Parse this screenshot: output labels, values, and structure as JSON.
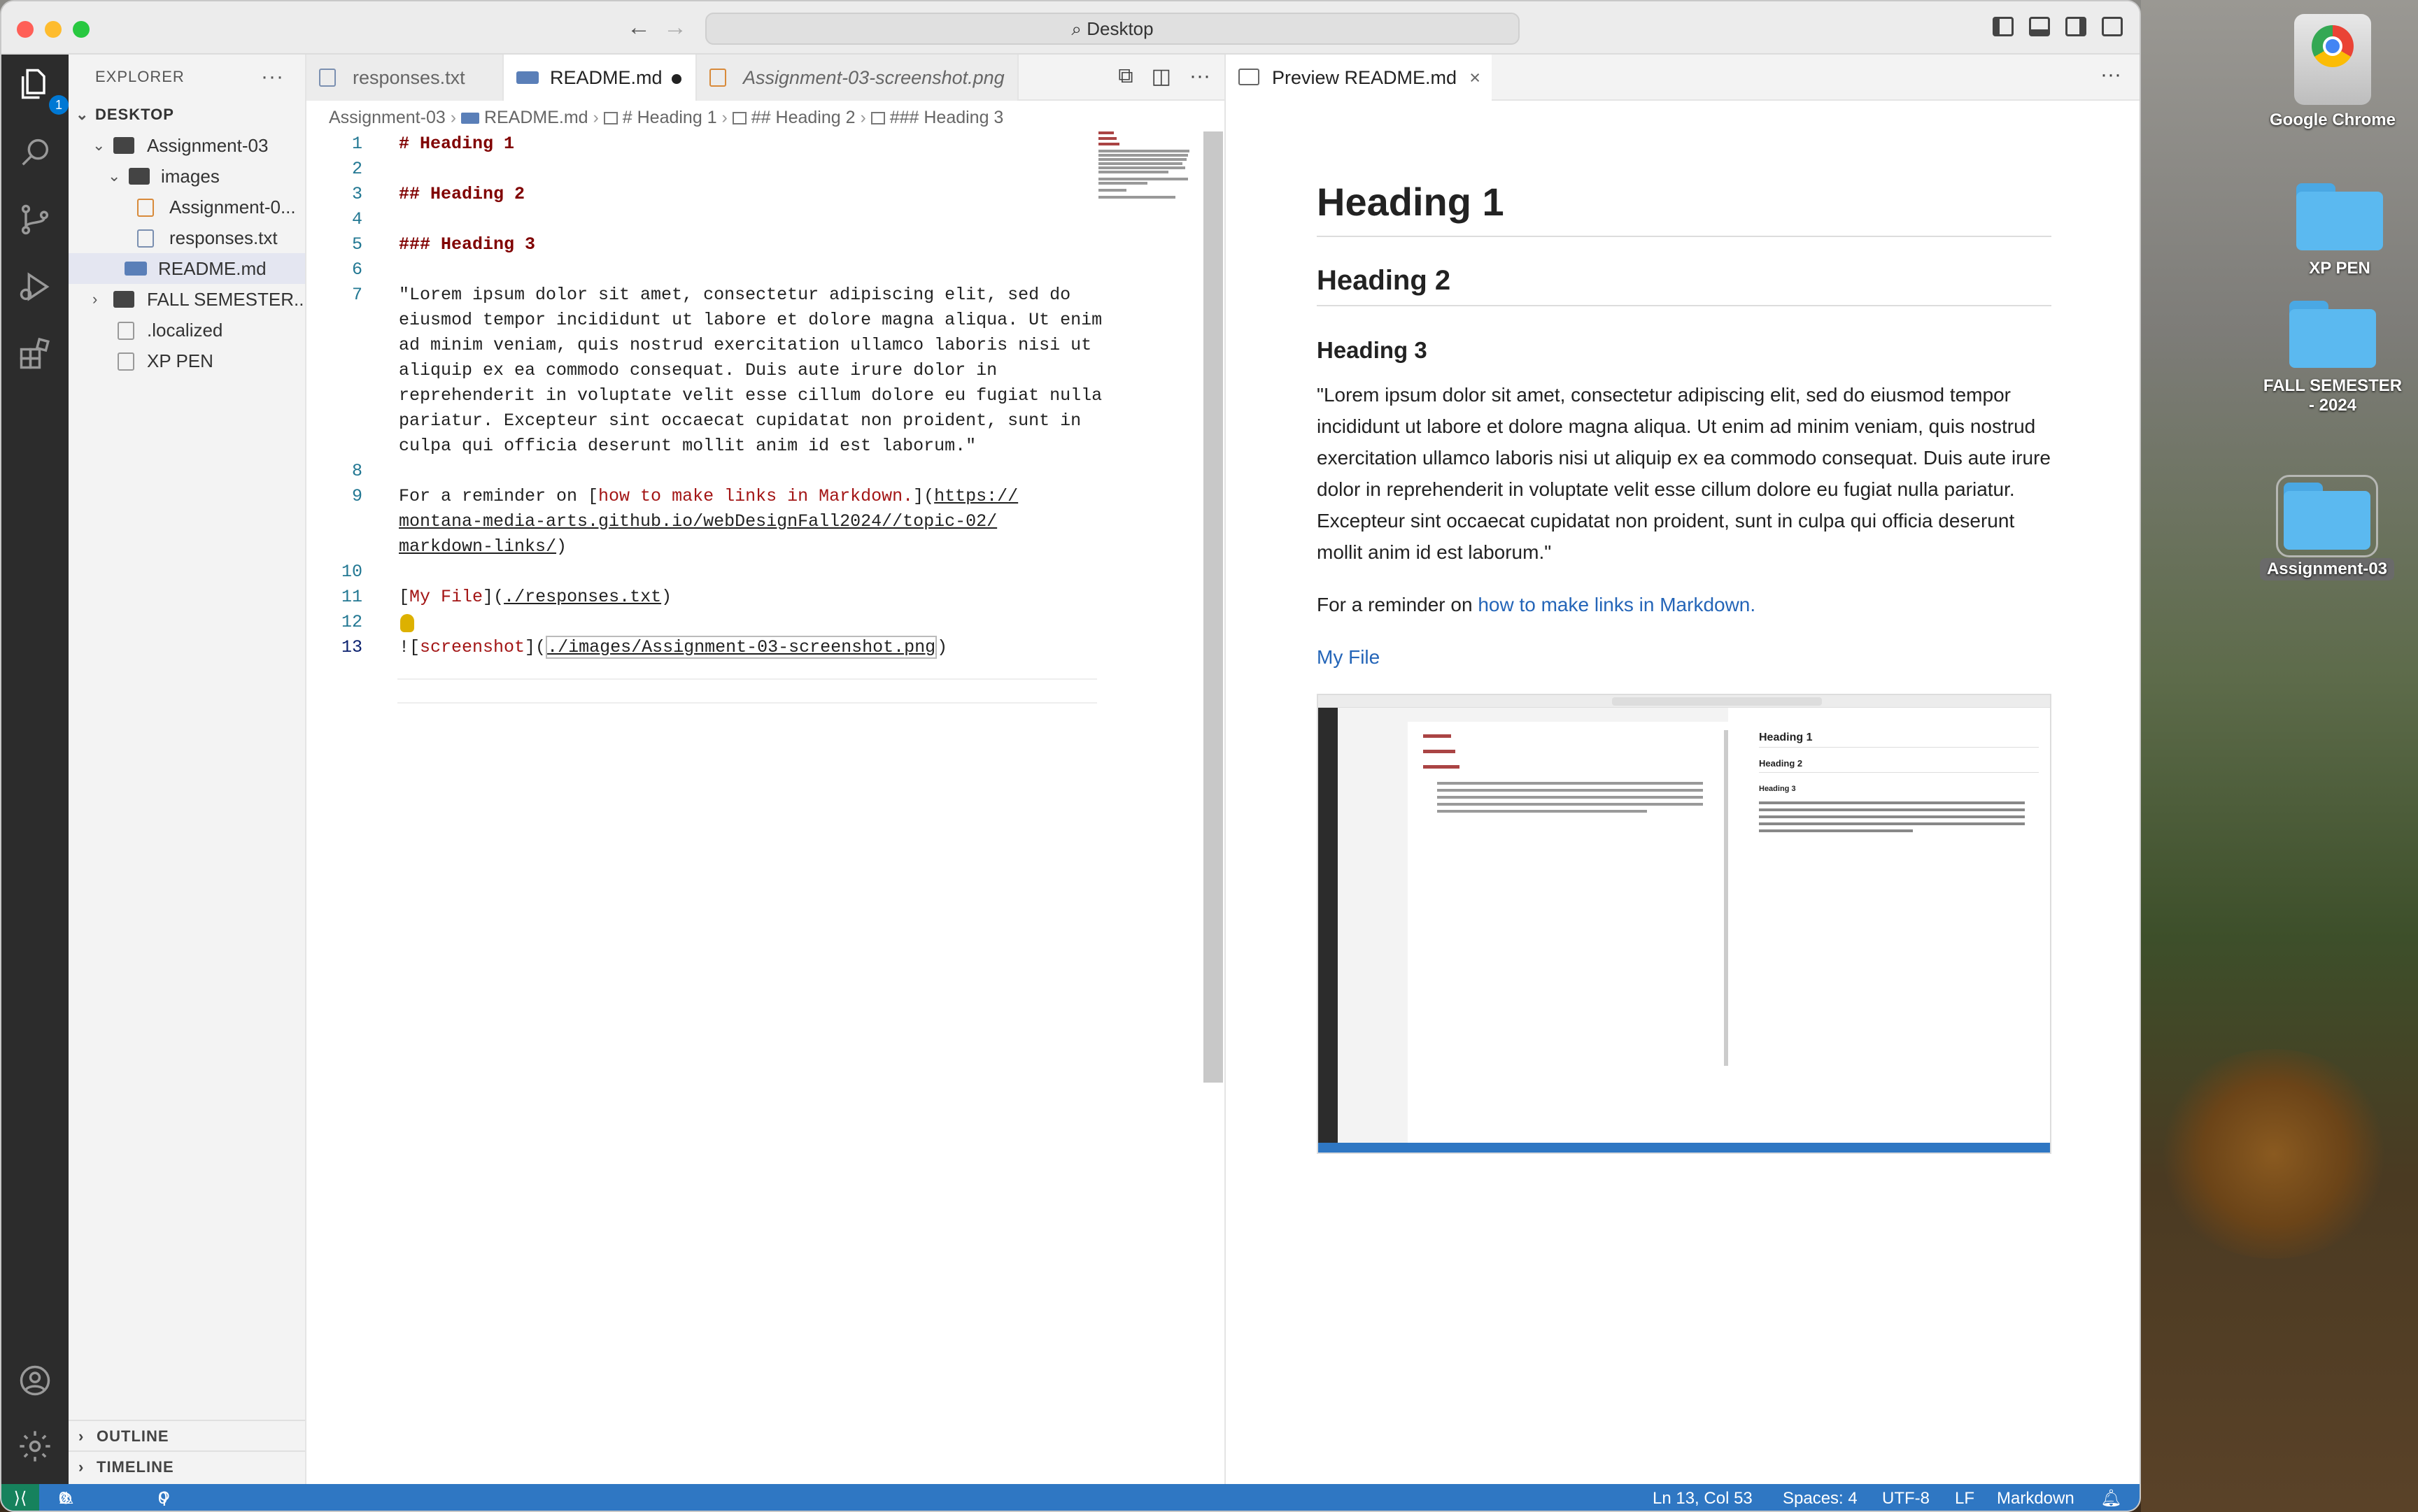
{
  "window": {
    "search_label": "Desktop"
  },
  "activity": {
    "explorer_badge": "1"
  },
  "sidebar": {
    "title": "EXPLORER",
    "section": "DESKTOP",
    "tree": [
      {
        "label": "Assignment-03",
        "type": "folder",
        "depth": 0,
        "open": true
      },
      {
        "label": "images",
        "type": "folder",
        "depth": 1,
        "open": true
      },
      {
        "label": "Assignment-0...",
        "type": "image",
        "depth": 2
      },
      {
        "label": "responses.txt",
        "type": "text",
        "depth": 2
      },
      {
        "label": "README.md",
        "type": "markdown",
        "depth": 1,
        "selected": true
      },
      {
        "label": "FALL SEMESTER...",
        "type": "folder",
        "depth": 0,
        "open": false
      },
      {
        "label": ".localized",
        "type": "text",
        "depth": 0
      },
      {
        "label": "XP PEN",
        "type": "text",
        "depth": 0
      }
    ],
    "outline": "OUTLINE",
    "timeline": "TIMELINE"
  },
  "editor": {
    "tabs": [
      {
        "label": "responses.txt",
        "dirty": false
      },
      {
        "label": "README.md",
        "dirty": true,
        "active": true
      },
      {
        "label": "Assignment-03-screenshot.png",
        "italic": true
      }
    ],
    "breadcrumb": [
      "Assignment-03",
      "README.md",
      "# Heading 1",
      "## Heading 2",
      "### Heading 3"
    ],
    "line_numbers": [
      "1",
      "2",
      "3",
      "4",
      "5",
      "6",
      "7",
      "8",
      "9",
      "10",
      "11",
      "12",
      "13"
    ],
    "lines": {
      "l1": "# Heading 1",
      "l3": "## Heading 2",
      "l5": "### Heading 3",
      "l7a": "\"Lorem ipsum dolor sit amet, consectetur adipiscing elit, sed do",
      "l7b": "eiusmod tempor incididunt ut labore et dolore magna aliqua. Ut enim",
      "l7c": "ad minim veniam, quis nostrud exercitation ullamco laboris nisi ut",
      "l7d": "aliquip ex ea commodo consequat. Duis aute irure dolor in",
      "l7e": "reprehenderit in voluptate velit esse cillum dolore eu fugiat nulla",
      "l7f": "pariatur. Excepteur sint occaecat cupidatat non proident, sunt in",
      "l7g": "culpa qui officia deserunt mollit anim id est laborum.\"",
      "l9_pre": "For a reminder on [",
      "l9_text": "how to make links in Markdown.",
      "l9_mid": "](",
      "l9_url1": "https://",
      "l9_url2": "montana-media-arts.github.io/webDesignFall2024//topic-02/",
      "l9_url3": "markdown-links/",
      "l9_end": ")",
      "l11_a": "[",
      "l11_text": "My File",
      "l11_b": "](",
      "l11_url": "./responses.txt",
      "l11_c": ")",
      "l13_a": "![",
      "l13_text": "screenshot",
      "l13_b": "](",
      "l13_url": "./images/Assignment-03-screenshot.png",
      "l13_c": ")"
    }
  },
  "preview": {
    "tab": "Preview README.md",
    "h1": "Heading 1",
    "h2": "Heading 2",
    "h3": "Heading 3",
    "para": "\"Lorem ipsum dolor sit amet, consectetur adipiscing elit, sed do eiusmod tempor incididunt ut labore et dolore magna aliqua. Ut enim ad minim veniam, quis nostrud exercitation ullamco laboris nisi ut aliquip ex ea commodo consequat. Duis aute irure dolor in reprehenderit in voluptate velit esse cillum dolore eu fugiat nulla pariatur. Excepteur sint occaecat cupidatat non proident, sunt in culpa qui officia deserunt mollit anim id est laborum.\"",
    "reminder_prefix": "For a reminder on ",
    "reminder_link": "how to make links in Markdown.",
    "file_link": "My File",
    "thumb": {
      "h1": "Heading 1",
      "h2": "Heading 2",
      "h3": "Heading 3"
    }
  },
  "status": {
    "errors": "0",
    "warnings": "0",
    "ports": "0",
    "position": "Ln 13, Col 53",
    "spaces": "Spaces: 4",
    "encoding": "UTF-8",
    "eol": "LF",
    "language": "Markdown"
  },
  "desktop": {
    "icons": [
      {
        "label": "Google Chrome"
      },
      {
        "label": "XP PEN"
      },
      {
        "label": "FALL SEMESTER - 2024"
      },
      {
        "label": "Assignment-03"
      }
    ]
  },
  "colors": {
    "accent": "#2f77c3",
    "heading_code": "#800000",
    "link_code": "#a31515",
    "preview_link": "#2465b8"
  }
}
